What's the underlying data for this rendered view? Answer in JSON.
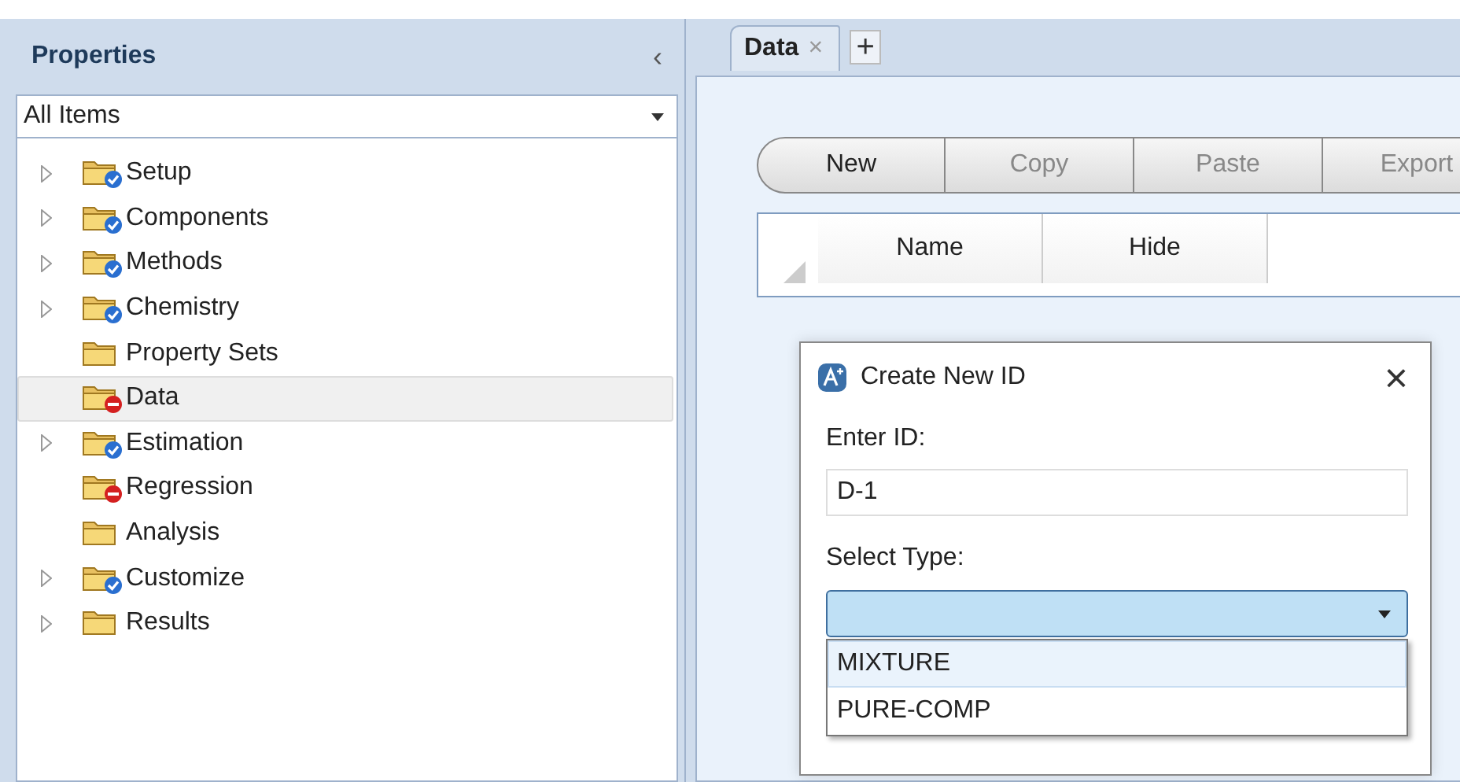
{
  "sidebar": {
    "title": "Properties",
    "collapse_glyph": "‹",
    "filter": {
      "value": "All Items"
    },
    "items": [
      {
        "label": "Setup",
        "expandable": true,
        "kind": "check",
        "selected": false
      },
      {
        "label": "Components",
        "expandable": true,
        "kind": "check",
        "selected": false
      },
      {
        "label": "Methods",
        "expandable": true,
        "kind": "check",
        "selected": false
      },
      {
        "label": "Chemistry",
        "expandable": true,
        "kind": "check",
        "selected": false
      },
      {
        "label": "Property Sets",
        "expandable": false,
        "kind": "plain",
        "selected": false
      },
      {
        "label": "Data",
        "expandable": false,
        "kind": "stop",
        "selected": true
      },
      {
        "label": "Estimation",
        "expandable": true,
        "kind": "check",
        "selected": false
      },
      {
        "label": "Regression",
        "expandable": false,
        "kind": "stop",
        "selected": false
      },
      {
        "label": "Analysis",
        "expandable": false,
        "kind": "plain",
        "selected": false
      },
      {
        "label": "Customize",
        "expandable": true,
        "kind": "check",
        "selected": false
      },
      {
        "label": "Results",
        "expandable": true,
        "kind": "plain",
        "selected": false
      }
    ]
  },
  "tabs": [
    {
      "label": "Data",
      "close": "×",
      "selected": true
    }
  ],
  "add_tab": "+",
  "toolbar": [
    {
      "label": "New",
      "disabled": false
    },
    {
      "label": "Copy",
      "disabled": true
    },
    {
      "label": "Paste",
      "disabled": true
    },
    {
      "label": "Export",
      "disabled": true
    }
  ],
  "table": {
    "columns": [
      "Name",
      "Hide"
    ]
  },
  "dialog": {
    "title": "Create New ID",
    "close": "×",
    "id_label": "Enter ID:",
    "id_value": "D-1",
    "type_label": "Select Type:",
    "options": [
      {
        "label": "MIXTURE",
        "selected": true
      },
      {
        "label": "PURE-COMP",
        "selected": false
      }
    ]
  }
}
